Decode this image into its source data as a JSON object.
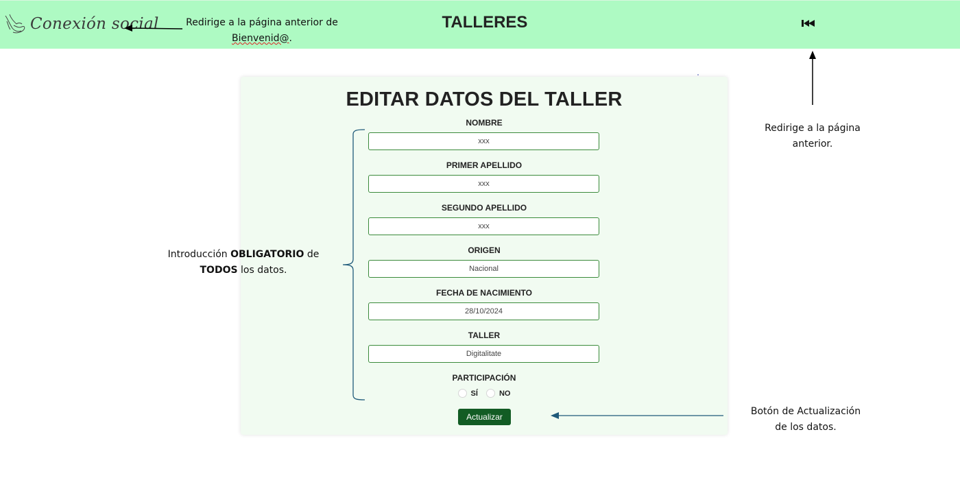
{
  "header": {
    "logo_text": "Conexión social",
    "title": "TALLERES",
    "back_icon": "skip-back-icon"
  },
  "form": {
    "title": "EDITAR DATOS DEL TALLER",
    "fields": [
      {
        "label": "NOMBRE",
        "value": "xxx"
      },
      {
        "label": "PRIMER APELLIDO",
        "value": "xxx"
      },
      {
        "label": "SEGUNDO APELLIDO",
        "value": "xxx"
      },
      {
        "label": "ORIGEN",
        "value": "Nacional"
      },
      {
        "label": "FECHA DE NACIMIENTO",
        "value": "28/10/2024"
      },
      {
        "label": "TALLER",
        "value": "Digitalitate"
      }
    ],
    "participation": {
      "label": "PARTICIPACIÓN",
      "options": [
        "SÍ",
        "NO"
      ]
    },
    "submit_label": "Actualizar"
  },
  "annotations": {
    "logo_note_line1": "Redirige a la página anterior de",
    "logo_note_word": "Bienvenid@",
    "logo_note_end": ".",
    "back_note_line1": "Redirige a la página",
    "back_note_line2": "anterior.",
    "required_note_pre": "Introducción ",
    "required_note_bold1": "OBLIGATORIO",
    "required_note_mid": " de",
    "required_note_bold2": "TODOS",
    "required_note_post": " los datos.",
    "update_note_line1": "Botón de Actualización",
    "update_note_line2": "de los datos."
  },
  "colors": {
    "header_bg": "#aefac3",
    "card_bg": "#f1fbf1",
    "input_border": "#3a8a3a",
    "button_bg": "#125c24",
    "annotation_arrow": "#1f5a7a"
  }
}
